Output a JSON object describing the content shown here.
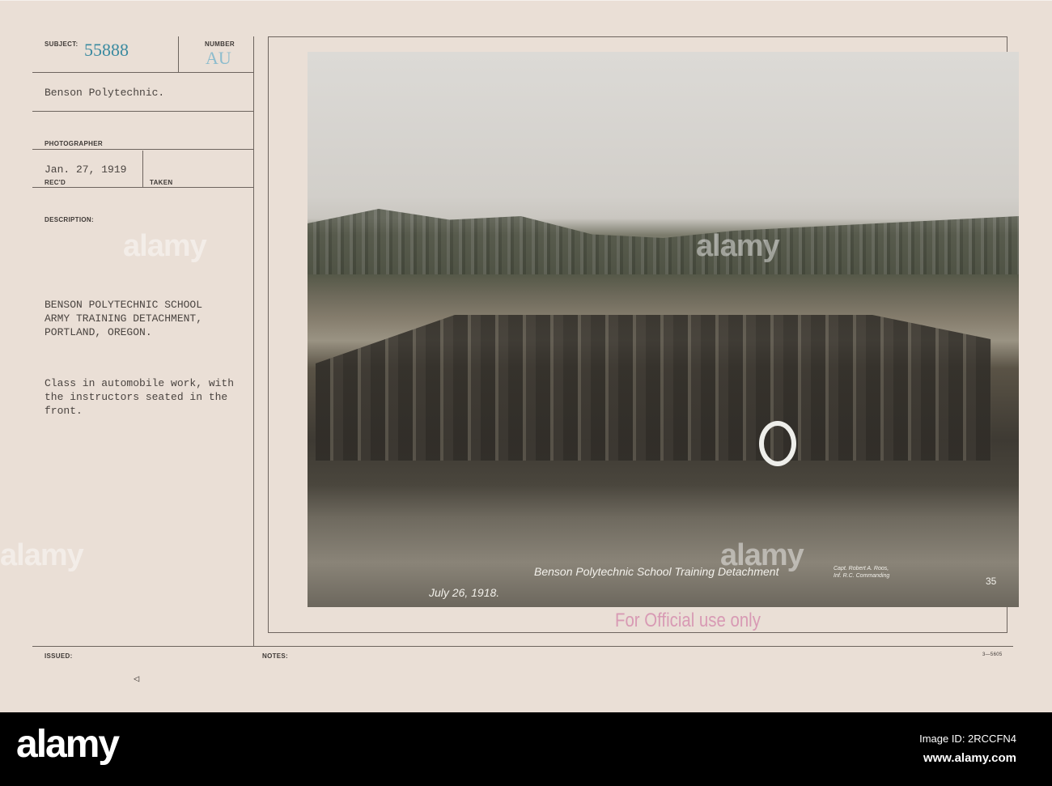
{
  "card": {
    "subject_label": "SUBJECT:",
    "subject_number": "55888",
    "number_label": "NUMBER",
    "number_value": "AU",
    "title": "Benson Polytechnic.",
    "photographer_label": "PHOTOGRAPHER",
    "received_date": "Jan. 27, 1919",
    "recd_label": "REC'D",
    "taken_label": "TAKEN",
    "description_label": "DESCRIPTION:",
    "description_heading": "BENSON POLYTECHNIC SCHOOL\nARMY TRAINING DETACHMENT,\nPORTLAND, OREGON.",
    "description_body": "Class in automobile work, with\nthe instructors seated in the\nfront.",
    "issued_label": "ISSUED:",
    "notes_label": "NOTES:",
    "form_number": "3—5605",
    "stamp": "For Official use only",
    "triangle_mark": "◁"
  },
  "photo": {
    "caption": "Benson Polytechnic School Training Detachment",
    "date": "July 26, 1918.",
    "credit": "Capt. Robert A. Roos,\nInf. R.C. Commanding",
    "plate_number": "35"
  },
  "footer": {
    "logo": "alamy",
    "image_id": "Image ID: 2RCCFN4",
    "url": "www.alamy.com"
  },
  "colors": {
    "stamp": "#d89ab4",
    "subject_ink": "#3a8aa0",
    "number_ink": "#8dbccd"
  }
}
